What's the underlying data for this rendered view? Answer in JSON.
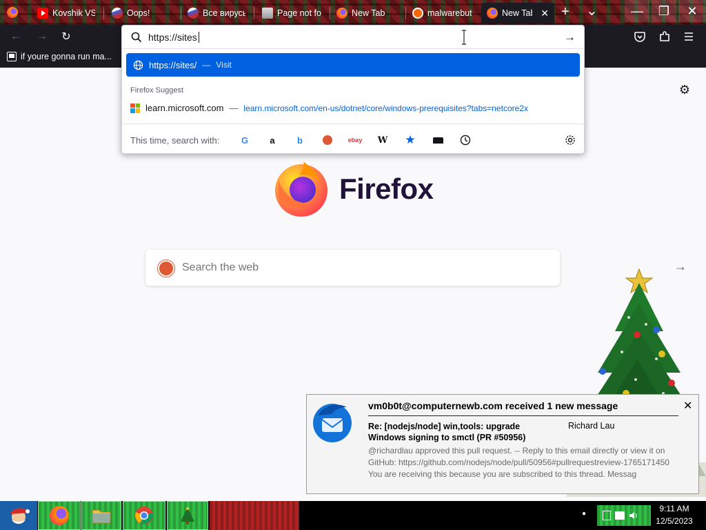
{
  "tabs": [
    {
      "label": "Kovshik VS M",
      "icon": "youtube-icon"
    },
    {
      "label": "Oops!",
      "icon": "jellyfish-icon"
    },
    {
      "label": "Все вирусы",
      "icon": "jellyfish-icon"
    },
    {
      "label": "Page not fou",
      "icon": "page-icon"
    },
    {
      "label": "New Tab",
      "icon": "firefox-icon"
    },
    {
      "label": "malwarebute",
      "icon": "malwarebytes-icon"
    },
    {
      "label": "New Tab",
      "icon": "firefox-icon",
      "active": true
    }
  ],
  "tab_close": "✕",
  "new_tab": "+",
  "list_tabs": "⌄",
  "window_controls": {
    "minimize": "—",
    "restore": "❐",
    "close": "✕"
  },
  "nav": {
    "back": "←",
    "forward": "→",
    "reload": "↻"
  },
  "bookmarks": [
    {
      "label": "if youre gonna run ma..."
    }
  ],
  "urlbar": {
    "value": "https://sites",
    "go": "→",
    "visit": {
      "url": "https://sites/",
      "sep": "—",
      "action": "Visit"
    },
    "suggest_title": "Firefox Suggest",
    "suggest": {
      "title": "learn.microsoft.com",
      "sep": "—",
      "url": "learn.microsoft.com/en-us/dotnet/core/windows-prerequisites?tabs=netcore2x"
    },
    "search_with": "This time, search with:",
    "engines": [
      "google",
      "amazon",
      "bing",
      "duckduckgo",
      "ebay",
      "wikipedia",
      "bookmarks",
      "tabs",
      "history",
      "settings"
    ]
  },
  "newtab": {
    "wordmark": "Firefox",
    "search_placeholder": "Search the web",
    "search_arrow": "→",
    "settings": "⚙"
  },
  "notification": {
    "title": "vm0b0t@computernewb.com received 1 new message",
    "close": "✕",
    "subject": "Re: [nodejs/node] win,tools: upgrade Windows signing to smctl (PR #50956)",
    "sender": "Richard Lau",
    "body": "@richardlau approved this pull request. -- Reply to this email directly or view it on GitHub: https://github.com/nodejs/node/pull/50956#pullrequestreview-1765171450 You are receiving this because you are subscribed to this thread. Messag"
  },
  "taskbar": {
    "time": "9:11 AM",
    "date": "12/5/2023",
    "dot": "●"
  },
  "colors": {
    "accent": "#0061e0",
    "titlebar": "#1c1b22",
    "brand": "#20123a"
  }
}
